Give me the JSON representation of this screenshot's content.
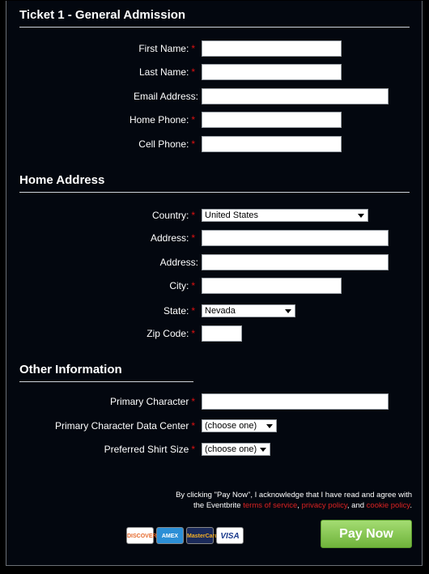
{
  "ticket_title": "Ticket 1 - General Admission",
  "required_marker": "*",
  "ticket_fields": [
    {
      "label": "First Name:",
      "required": true
    },
    {
      "label": "Last Name:",
      "required": true
    },
    {
      "label": "Email Address:",
      "required": false
    },
    {
      "label": "Home Phone:",
      "required": true
    },
    {
      "label": "Cell Phone:",
      "required": true
    }
  ],
  "home_address_title": "Home Address",
  "address_fields": {
    "country": {
      "label": "Country:",
      "value": "United States"
    },
    "address1": {
      "label": "Address:"
    },
    "address2": {
      "label": "Address:"
    },
    "city": {
      "label": "City:"
    },
    "state": {
      "label": "State:",
      "value": "Nevada"
    },
    "zip": {
      "label": "Zip Code:"
    }
  },
  "other_title": "Other Information",
  "other_fields": {
    "primary_character": {
      "label": "Primary Character"
    },
    "data_center": {
      "label": "Primary Character Data Center",
      "value": "(choose one)"
    },
    "shirt_size": {
      "label": "Preferred Shirt Size",
      "value": "(choose one)"
    }
  },
  "legal": {
    "line1": "By clicking \"Pay Now\", I acknowledge that I have read and agree with",
    "prefix": "the Eventbrite ",
    "terms": "terms of service",
    "comma": ", ",
    "privacy": "privacy policy",
    "and": ", and ",
    "cookie": "cookie policy",
    "period": "."
  },
  "cards": [
    {
      "name": "DISCOVER",
      "icon": "discover-card-icon",
      "bg": "#ffffff",
      "fg": "#e5692c"
    },
    {
      "name": "AMEX",
      "icon": "amex-card-icon",
      "bg": "#2c8fd6",
      "fg": "#ffffff"
    },
    {
      "name": "MasterCard",
      "icon": "mastercard-icon",
      "bg": "#1b2a5a",
      "fg": "#f5b025"
    },
    {
      "name": "VISA",
      "icon": "visa-card-icon",
      "bg": "#ffffff",
      "fg": "#1a3a8c"
    }
  ],
  "pay_button": "Pay Now",
  "colors": {
    "required": "#dd1111",
    "link": "#dd2222",
    "pay_green": "#7cc043"
  }
}
